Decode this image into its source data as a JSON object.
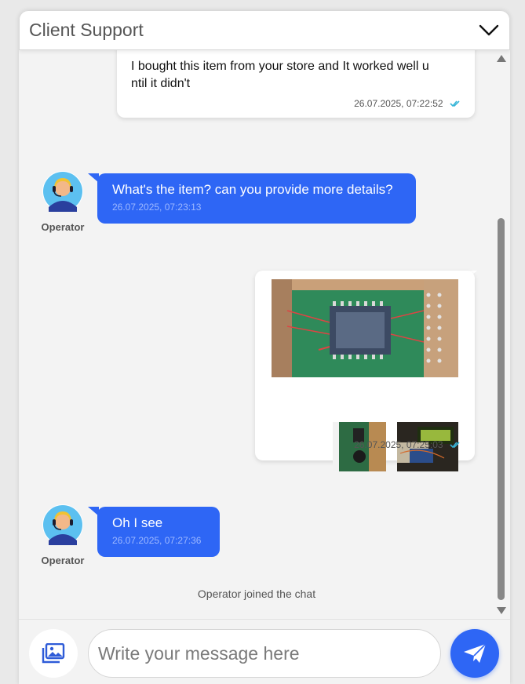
{
  "header": {
    "title": "Client Support"
  },
  "messages": [
    {
      "text": "I bought this item from your store and It worked well u\nntil it didn't",
      "timestamp": "26.07.2025, 07:22:52"
    },
    {
      "text": "What's the item? can you provide more details?",
      "timestamp": "26.07.2025, 07:23:13",
      "sender": "Operator"
    },
    {
      "timestamp": "26.07.2025, 07:25:03"
    },
    {
      "text": "Oh I see",
      "timestamp": "26.07.2025, 07:27:36",
      "sender": "Operator"
    }
  ],
  "system_note": "Operator joined the chat",
  "composer": {
    "placeholder": "Write your message here"
  },
  "colors": {
    "accent": "#2e66f5",
    "read_check": "#38b6d8"
  },
  "icons": {
    "collapse": "chevron-down-icon",
    "attach": "image-upload-icon",
    "send": "paper-plane-icon"
  }
}
